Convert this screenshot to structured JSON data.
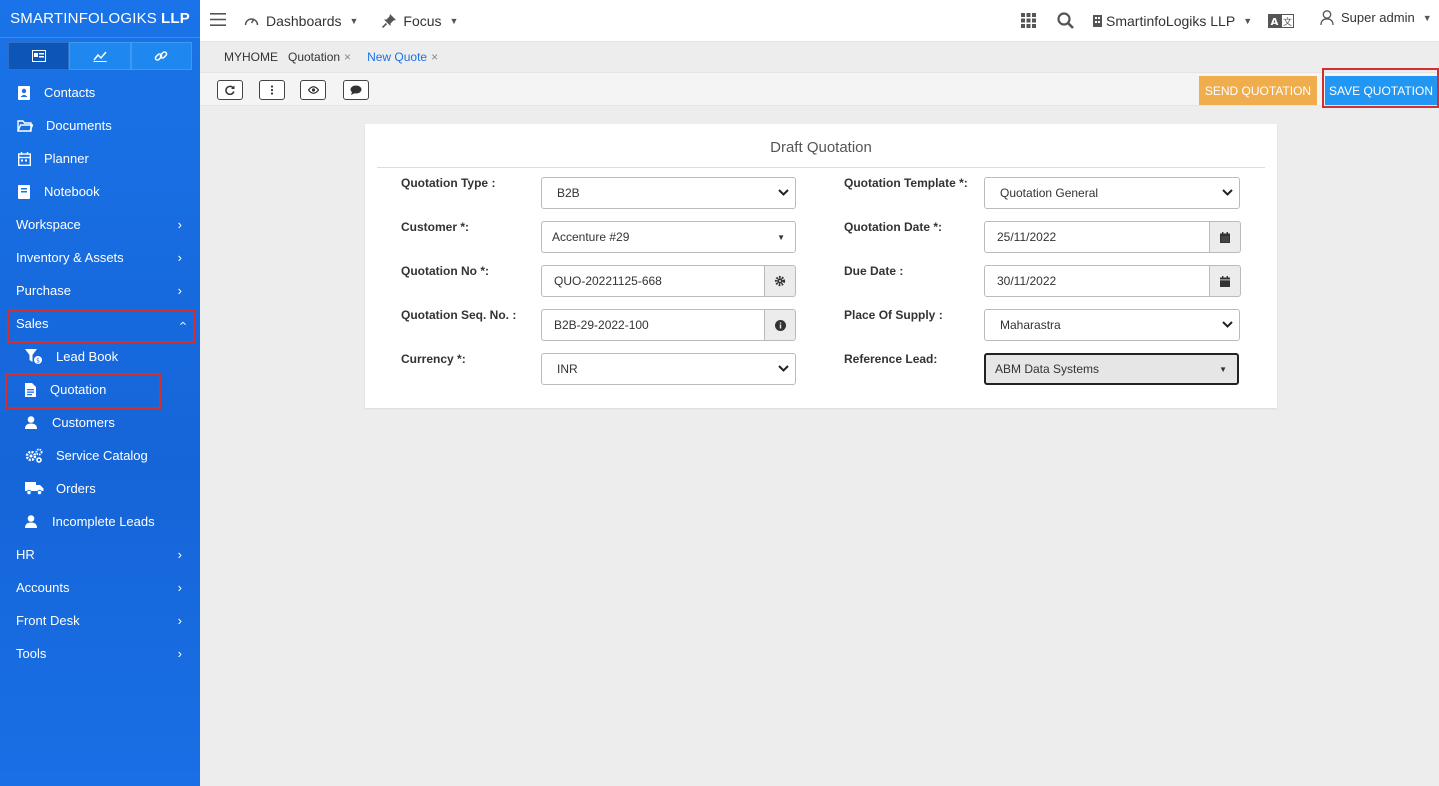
{
  "brand": {
    "name_thin": "SMARTINFOLOGIKS",
    "name_bold": "LLP"
  },
  "sidebar": {
    "icon_tabs": [
      "dashboard-icon",
      "chart-icon",
      "link-icon"
    ],
    "items": [
      {
        "label": "Contacts",
        "icon": "contact-icon"
      },
      {
        "label": "Documents",
        "icon": "folder-icon"
      },
      {
        "label": "Planner",
        "icon": "calendar-icon"
      },
      {
        "label": "Notebook",
        "icon": "notebook-icon"
      },
      {
        "label": "Workspace"
      },
      {
        "label": "Inventory & Assets"
      },
      {
        "label": "Purchase"
      },
      {
        "label": "Sales"
      }
    ],
    "sales_sub": [
      {
        "label": "Lead Book",
        "icon": "funnel-icon"
      },
      {
        "label": "Quotation",
        "icon": "document-icon"
      },
      {
        "label": "Customers",
        "icon": "user-icon"
      },
      {
        "label": "Service Catalog",
        "icon": "gears-icon"
      },
      {
        "label": "Orders",
        "icon": "truck-icon"
      },
      {
        "label": "Incomplete Leads",
        "icon": "user-icon"
      }
    ],
    "bottom": [
      {
        "label": "HR"
      },
      {
        "label": "Accounts"
      },
      {
        "label": "Front Desk"
      },
      {
        "label": "Tools"
      }
    ]
  },
  "topbar": {
    "dashboards": "Dashboards",
    "focus": "Focus",
    "company": "SmartinfoLogiks LLP",
    "user": "Super admin"
  },
  "breadcrumbs": {
    "home": "MYHOME",
    "tab1": "Quotation",
    "tab2": "New Quote",
    "close": "×"
  },
  "actions": {
    "send": "SEND QUOTATION",
    "save": "SAVE QUOTATION"
  },
  "form": {
    "title": "Draft Quotation",
    "left": [
      {
        "label": "Quotation Type :",
        "value": "B2B"
      },
      {
        "label": "Customer *:",
        "value": "Accenture #29"
      },
      {
        "label": "Quotation No *:",
        "value": "QUO-20221125-668"
      },
      {
        "label": "Quotation Seq. No. :",
        "value": "B2B-29-2022-100"
      },
      {
        "label": "Currency *:",
        "value": "INR"
      }
    ],
    "right": [
      {
        "label": "Quotation Template *:",
        "value": "Quotation General"
      },
      {
        "label": "Quotation Date *:",
        "value": "25/11/2022"
      },
      {
        "label": "Due Date :",
        "value": "30/11/2022"
      },
      {
        "label": "Place Of Supply :",
        "value": "Maharastra"
      },
      {
        "label": "Reference Lead:",
        "value": "ABM Data Systems"
      }
    ]
  },
  "colors": {
    "sidebar": "#1a73e8",
    "send": "#f0ad4e",
    "save": "#2196f3",
    "highlight": "#d32f2f"
  }
}
